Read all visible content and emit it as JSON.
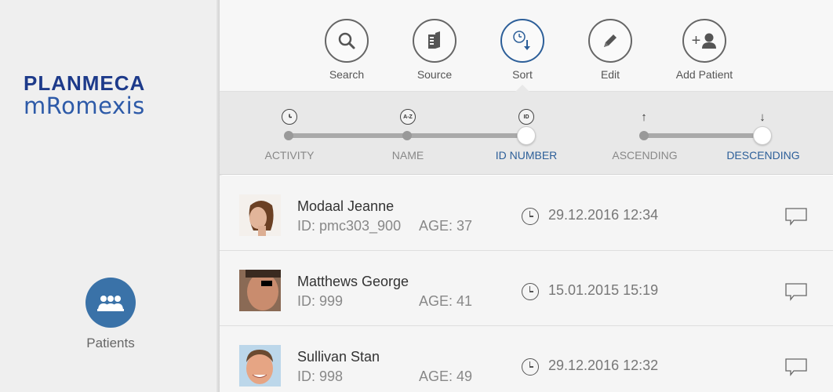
{
  "brand": {
    "line1": "PLANMECA",
    "line2": "mRomexis"
  },
  "sidebar": {
    "patients_label": "Patients"
  },
  "toolbar": {
    "search_label": "Search",
    "source_label": "Source",
    "sort_label": "Sort",
    "edit_label": "Edit",
    "add_patient_label": "Add Patient",
    "add_patient_icon_text": "+"
  },
  "sort": {
    "field_options": [
      "ACTIVITY",
      "NAME",
      "ID NUMBER"
    ],
    "field_selected": "ID NUMBER",
    "name_icon_text": "A-Z",
    "id_icon_text": "ID",
    "order_options": [
      "ASCENDING",
      "DESCENDING"
    ],
    "order_selected": "DESCENDING",
    "ascending_icon": "↑",
    "descending_icon": "↓"
  },
  "patients": [
    {
      "name": "Modaal Jeanne",
      "id": "ID: pmc303_900",
      "age": "AGE: 37",
      "date": "29.12.2016 12:34"
    },
    {
      "name": "Matthews George",
      "id": "ID: 999",
      "age": "AGE: 41",
      "date": "15.01.2015 15:19"
    },
    {
      "name": "Sullivan Stan",
      "id": "ID: 998",
      "age": "AGE: 49",
      "date": "29.12.2016 12:32"
    }
  ],
  "colors": {
    "accent": "#2d5f99",
    "brand": "#1d3a8a",
    "patients_button": "#3a72a8"
  }
}
